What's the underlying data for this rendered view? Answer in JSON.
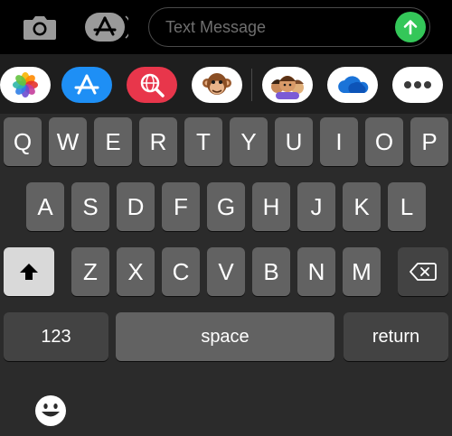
{
  "message": {
    "placeholder": "Text Message"
  },
  "colors": {
    "send": "#34c759",
    "key": "#626262",
    "key_dark": "#434343",
    "shift": "#d9d9d9"
  },
  "icons": {
    "camera": "camera-icon",
    "app_store_toggle": "app-store-icon",
    "send": "arrow-up-icon",
    "apps": [
      "photos-icon",
      "app-store-icon",
      "web-search-icon",
      "monkey-memoji-icon",
      "memoji-stickers-icon",
      "onedrive-icon",
      "more-icon"
    ],
    "shift": "shift-arrow-icon",
    "backspace": "delete-icon",
    "emoji": "emoji-icon"
  },
  "keyboard": {
    "row1": [
      "Q",
      "W",
      "E",
      "R",
      "T",
      "Y",
      "U",
      "I",
      "O",
      "P"
    ],
    "row2": [
      "A",
      "S",
      "D",
      "F",
      "G",
      "H",
      "J",
      "K",
      "L"
    ],
    "row3": [
      "Z",
      "X",
      "C",
      "V",
      "B",
      "N",
      "M"
    ],
    "numbers_label": "123",
    "space_label": "space",
    "return_label": "return"
  }
}
